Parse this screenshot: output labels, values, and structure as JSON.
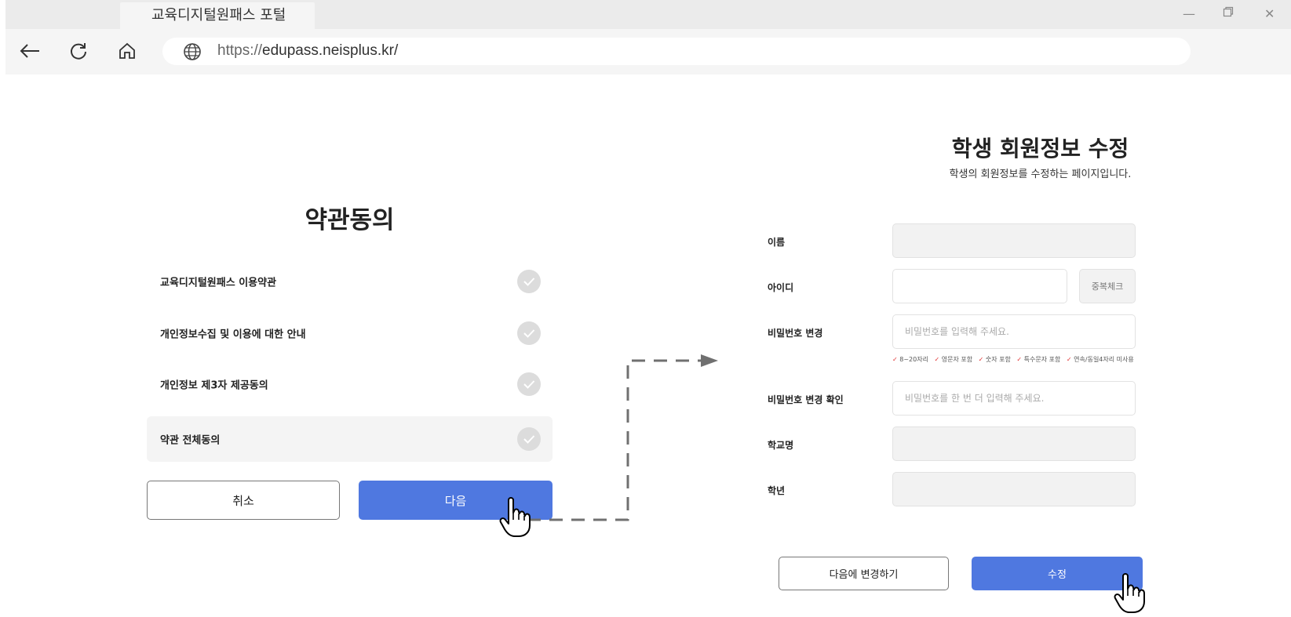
{
  "browser": {
    "tab_title": "교육디지털원패스 포털",
    "url_protocol": "https://",
    "url_host": "edupass.neisplus.kr/"
  },
  "terms": {
    "title": "약관동의",
    "items": [
      {
        "label": "교육디지털원패스 이용약관"
      },
      {
        "label": "개인정보수집 및 이용에 대한 안내"
      },
      {
        "label": "개인정보 제3자 제공동의"
      }
    ],
    "agree_all": "약관 전체동의",
    "cancel_label": "취소",
    "next_label": "다음"
  },
  "edit": {
    "title": "학생 회원정보 수정",
    "subtitle": "학생의 회원정보를 수정하는 페이지입니다.",
    "name_label": "이름",
    "id_label": "아이디",
    "dup_check_label": "중복체크",
    "password_label": "비밀번호 변경",
    "password_placeholder": "비밀번호를 입력해 주세요.",
    "rules": [
      "8~20자리",
      "영문자 포함",
      "숫자 포함",
      "특수문자 포함",
      "연속/동일4자리 미사용"
    ],
    "password_confirm_label": "비밀번호 변경 확인",
    "password_confirm_placeholder": "비밀번호를 한 번 더 입력해 주세요.",
    "school_label": "학교명",
    "grade_label": "학년",
    "later_label": "다음에 변경하기",
    "submit_label": "수정"
  },
  "colors": {
    "primary": "#4f78e0",
    "check_gray": "#dcdcdc",
    "rule_check": "#e03030"
  }
}
